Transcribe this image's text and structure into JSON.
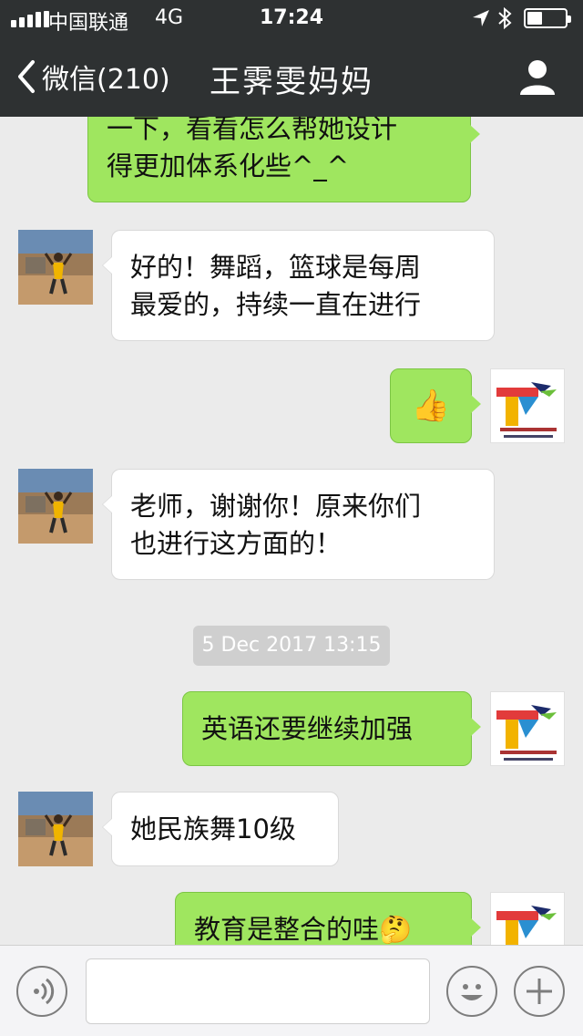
{
  "status_bar": {
    "carrier": "中国联通",
    "network": "4G",
    "time": "17:24"
  },
  "nav": {
    "back_label": "微信(210)",
    "title": "王霁雯妈妈"
  },
  "messages": [
    {
      "from": "teacher",
      "type": "text",
      "text": "一下，看看怎么帮她设计\n得更加体系化些^_^"
    },
    {
      "from": "mom",
      "type": "text",
      "text": "好的！舞蹈，篮球是每周\n最爱的，持续一直在进行"
    },
    {
      "from": "teacher",
      "type": "emoji",
      "emoji": "👍"
    },
    {
      "from": "mom",
      "type": "text",
      "text": "老师，谢谢你！原来你们\n也进行这方面的！"
    },
    {
      "type": "timestamp",
      "text": "5 Dec 2017 13:15"
    },
    {
      "from": "teacher",
      "type": "text",
      "text": "英语还要继续加强"
    },
    {
      "from": "mom",
      "type": "text",
      "text": "她民族舞10级"
    },
    {
      "from": "teacher",
      "type": "text",
      "text": "教育是整合的哇🤔"
    }
  ],
  "input_bar": {
    "voice_icon": "voice-icon",
    "emoji_icon": "emoji-icon",
    "more_icon": "plus-icon",
    "text_value": ""
  },
  "colors": {
    "header": "#2e3132",
    "chat_bg": "#ebebeb",
    "out_bubble": "#9fe65f",
    "in_bubble": "#ffffff"
  }
}
